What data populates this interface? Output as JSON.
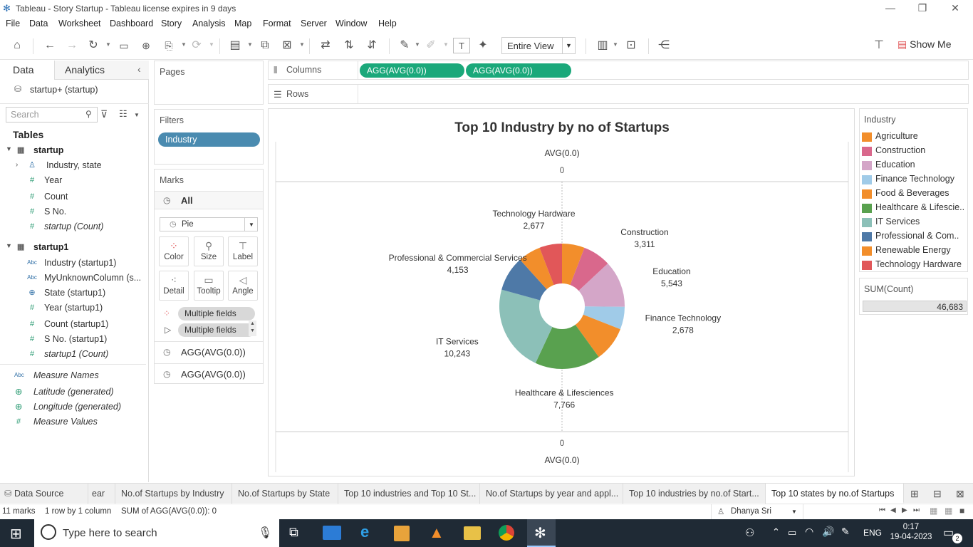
{
  "window": {
    "title": "Tableau - Story Startup - Tableau license expires in 9 days"
  },
  "menu": [
    "File",
    "Data",
    "Worksheet",
    "Dashboard",
    "Story",
    "Analysis",
    "Map",
    "Format",
    "Server",
    "Window",
    "Help"
  ],
  "toolbar": {
    "view_select": "Entire View",
    "show_me": "Show Me"
  },
  "datapane": {
    "tab_data": "Data",
    "tab_analytics": "Analytics",
    "datasource": "startup+ (startup)",
    "search_placeholder": "Search",
    "tables_header": "Tables",
    "table1": {
      "name": "startup",
      "fields": [
        "Industry, state",
        "Year",
        "Count",
        "S No.",
        "startup (Count)"
      ]
    },
    "table2": {
      "name": "startup1",
      "fields": [
        "Industry (startup1)",
        "MyUnknownColumn (s...",
        "State (startup1)",
        "Year (startup1)",
        "Count (startup1)",
        "S No. (startup1)",
        "startup1 (Count)"
      ]
    },
    "extras": [
      "Measure Names",
      "Latitude (generated)",
      "Longitude (generated)",
      "Measure Values"
    ],
    "abc": "Abc"
  },
  "shelves": {
    "pages": "Pages",
    "columns": "Columns",
    "rows": "Rows",
    "col_pill_1": "AGG(AVG(0.0))",
    "col_pill_2": "AGG(AVG(0.0))"
  },
  "filters": {
    "header": "Filters",
    "pill": "Industry"
  },
  "marks": {
    "header": "Marks",
    "all": "All",
    "type": "Pie",
    "buttons": [
      "Color",
      "Size",
      "Label",
      "Detail",
      "Tooltip",
      "Angle"
    ],
    "multi1": "Multiple fields",
    "multi2": "Multiple fields",
    "agg1": "AGG(AVG(0.0))",
    "agg2": "AGG(AVG(0.0))"
  },
  "chart_data": {
    "type": "pie",
    "title": "Top 10 Industry by no of Startups",
    "top_axis_title": "AVG(0.0)",
    "top_axis_tick": "0",
    "bottom_axis_title": "AVG(0.0)",
    "bottom_axis_tick": "0",
    "slices": [
      {
        "name": "Agriculture",
        "value": 2677,
        "color": "#f28e2b",
        "label": false
      },
      {
        "name": "Construction",
        "value": 3311,
        "color": "#d9688c",
        "label": true
      },
      {
        "name": "Education",
        "value": 5543,
        "color": "#d4a6c8",
        "label": true
      },
      {
        "name": "Finance Technology",
        "value": 2678,
        "color": "#a0cbe8",
        "label": true
      },
      {
        "name": "Food & Beverages",
        "value": 4153,
        "color": "#f28e2b",
        "label": false
      },
      {
        "name": "Healthcare & Lifesciences",
        "value": 7766,
        "color": "#59a14f",
        "label": true
      },
      {
        "name": "IT Services",
        "value": 10243,
        "color": "#8cc0b8",
        "label": true
      },
      {
        "name": "Professional & Commercial Services",
        "value": 4153,
        "color": "#4e79a7",
        "label": true
      },
      {
        "name": "Renewable Energy",
        "value": 2677,
        "color": "#f28e2b",
        "label": false
      },
      {
        "name": "Technology Hardware",
        "value": 2677,
        "color": "#e15759",
        "label": true
      }
    ],
    "labels": [
      {
        "name": "Technology Hardware",
        "value": "2,677"
      },
      {
        "name": "Construction",
        "value": "3,311"
      },
      {
        "name": "Professional & Commercial Services",
        "value": "4,153"
      },
      {
        "name": "Education",
        "value": "5,543"
      },
      {
        "name": "IT Services",
        "value": "10,243"
      },
      {
        "name": "Finance Technology",
        "value": "2,678"
      },
      {
        "name": "Healthcare & Lifesciences",
        "value": "7,766"
      }
    ]
  },
  "legend": {
    "title": "Industry",
    "items": [
      {
        "name": "Agriculture",
        "color": "#f28e2b"
      },
      {
        "name": "Construction",
        "color": "#d9688c"
      },
      {
        "name": "Education",
        "color": "#d4a6c8"
      },
      {
        "name": "Finance Technology",
        "color": "#a0cbe8"
      },
      {
        "name": "Food & Beverages",
        "color": "#f28e2b"
      },
      {
        "name": "Healthcare & Lifescie..",
        "color": "#59a14f"
      },
      {
        "name": "IT Services",
        "color": "#8cc0b8"
      },
      {
        "name": "Professional & Com..",
        "color": "#4e79a7"
      },
      {
        "name": "Renewable Energy",
        "color": "#f28e2b"
      },
      {
        "name": "Technology Hardware",
        "color": "#e15759"
      }
    ],
    "size_title": "SUM(Count)",
    "size_value": "46,683"
  },
  "tabs": [
    {
      "label": "Data Source"
    },
    {
      "label": "ear"
    },
    {
      "label": "No.of Startups by Industry"
    },
    {
      "label": "No.of Startups by State"
    },
    {
      "label": "Top 10 industries and Top 10 St..."
    },
    {
      "label": "No.of Startups by year and appl..."
    },
    {
      "label": "Top 10 industries by no.of Start..."
    },
    {
      "label": "Top 10 states by no.of Startups"
    }
  ],
  "status": {
    "marks": "11 marks",
    "dims": "1 row by 1 column",
    "sum": "SUM of AGG(AVG(0.0)): 0",
    "user": "Dhanya Sri"
  },
  "taskbar": {
    "search": "Type here to search",
    "lang": "ENG",
    "time": "0:17",
    "date": "19-04-2023",
    "notif": "2"
  }
}
